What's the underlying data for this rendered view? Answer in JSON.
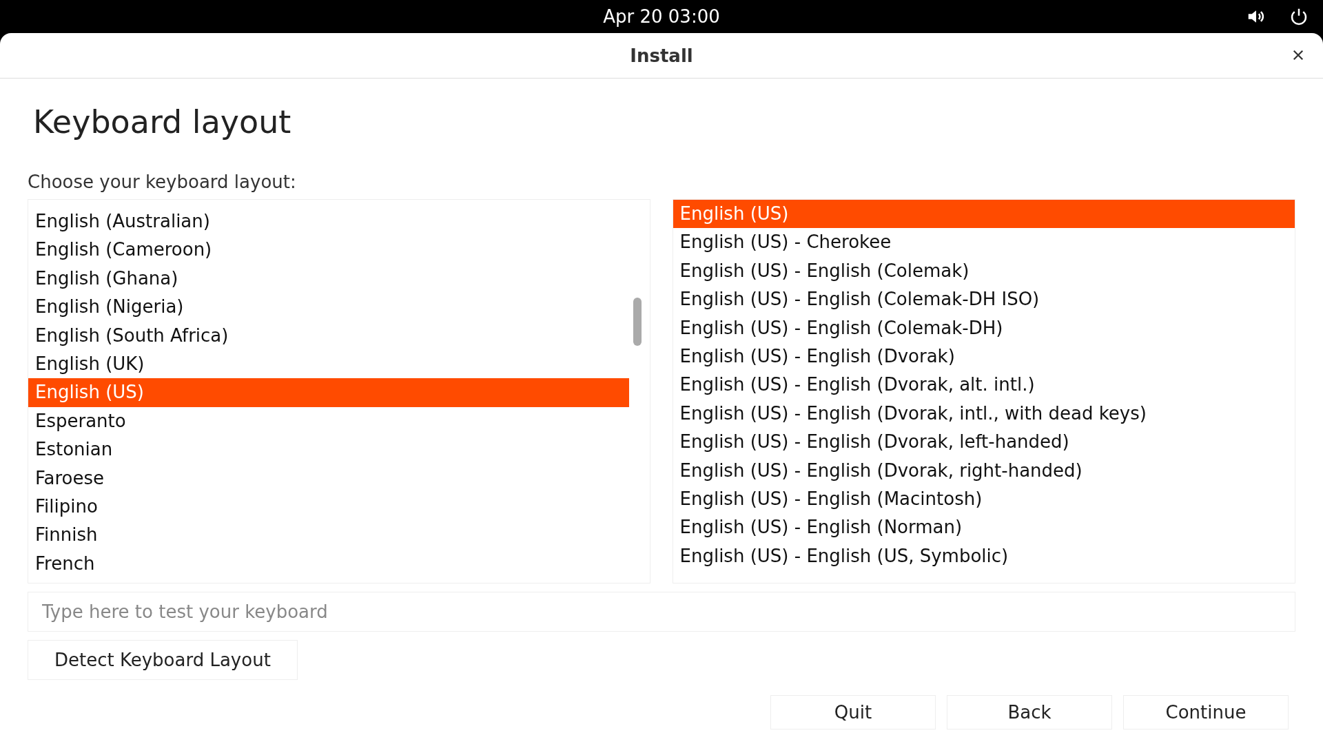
{
  "top_bar": {
    "clock": "Apr 20  03:00"
  },
  "window": {
    "title": "Install"
  },
  "page": {
    "heading": "Keyboard layout",
    "prompt": "Choose your keyboard layout:"
  },
  "layouts": [
    {
      "label": "English (Australian)",
      "selected": false
    },
    {
      "label": "English (Cameroon)",
      "selected": false
    },
    {
      "label": "English (Ghana)",
      "selected": false
    },
    {
      "label": "English (Nigeria)",
      "selected": false
    },
    {
      "label": "English (South Africa)",
      "selected": false
    },
    {
      "label": "English (UK)",
      "selected": false
    },
    {
      "label": "English (US)",
      "selected": true
    },
    {
      "label": "Esperanto",
      "selected": false
    },
    {
      "label": "Estonian",
      "selected": false
    },
    {
      "label": "Faroese",
      "selected": false
    },
    {
      "label": "Filipino",
      "selected": false
    },
    {
      "label": "Finnish",
      "selected": false
    },
    {
      "label": "French",
      "selected": false
    }
  ],
  "variants": [
    {
      "label": "English (US)",
      "selected": true
    },
    {
      "label": "English (US) - Cherokee",
      "selected": false
    },
    {
      "label": "English (US) - English (Colemak)",
      "selected": false
    },
    {
      "label": "English (US) - English (Colemak-DH ISO)",
      "selected": false
    },
    {
      "label": "English (US) - English (Colemak-DH)",
      "selected": false
    },
    {
      "label": "English (US) - English (Dvorak)",
      "selected": false
    },
    {
      "label": "English (US) - English (Dvorak, alt. intl.)",
      "selected": false
    },
    {
      "label": "English (US) - English (Dvorak, intl., with dead keys)",
      "selected": false
    },
    {
      "label": "English (US) - English (Dvorak, left-handed)",
      "selected": false
    },
    {
      "label": "English (US) - English (Dvorak, right-handed)",
      "selected": false
    },
    {
      "label": "English (US) - English (Macintosh)",
      "selected": false
    },
    {
      "label": "English (US) - English (Norman)",
      "selected": false
    },
    {
      "label": "English (US) - English (US, Symbolic)",
      "selected": false
    }
  ],
  "test_field": {
    "placeholder": "Type here to test your keyboard"
  },
  "detect_button": "Detect Keyboard Layout",
  "buttons": [
    "Quit",
    "Back",
    "Continue"
  ]
}
